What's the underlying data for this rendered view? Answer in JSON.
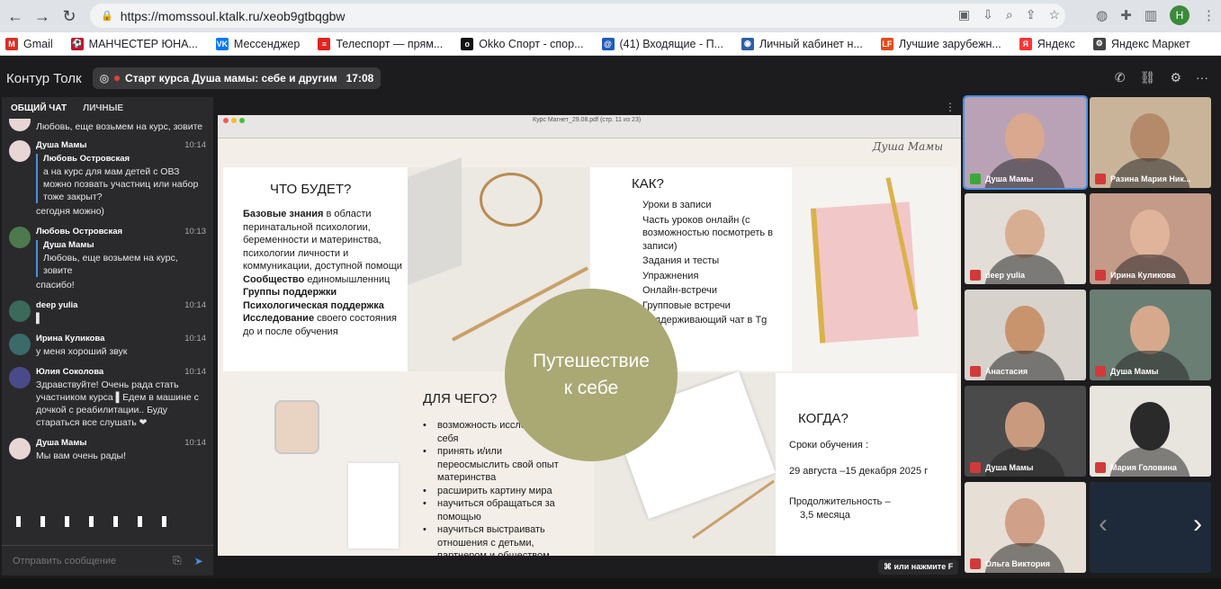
{
  "browser": {
    "url": "https://momssoul.ktalk.ru/xeob9gtbqgbw",
    "profile_initial": "Н",
    "bookmarks": [
      {
        "label": "Gmail",
        "color": "#d93025",
        "glyph": "M"
      },
      {
        "label": "МАНЧЕСТЕР ЮНА...",
        "color": "#c8102e",
        "glyph": "⚽"
      },
      {
        "label": "Мессенджер",
        "color": "#0077ff",
        "glyph": "VK"
      },
      {
        "label": "Телеспорт — прям...",
        "color": "#e0241f",
        "glyph": "≡"
      },
      {
        "label": "Okko Спорт - спор...",
        "color": "#111111",
        "glyph": "o"
      },
      {
        "label": "(41) Входящие - П...",
        "color": "#1e5bbd",
        "glyph": "@"
      },
      {
        "label": "Личный кабинет н...",
        "color": "#2a5fa8",
        "glyph": "◉"
      },
      {
        "label": "Лучшие зарубежн...",
        "color": "#e64a19",
        "glyph": "LF"
      },
      {
        "label": "Яндекс",
        "color": "#ff3333",
        "glyph": "Я"
      },
      {
        "label": "Яндекс Маркет",
        "color": "#444444",
        "glyph": "⚙"
      }
    ]
  },
  "app": {
    "brand": "Контур Толк",
    "meeting_title": "Старт курса Душа мамы: себе и другим",
    "meeting_time": "17:08"
  },
  "chat": {
    "tab_common": "ОБЩИЙ ЧАТ",
    "tab_private": "ЛИЧНЫЕ",
    "top_partial": "Любовь, еще возьмем на курс, зовите",
    "messages": [
      {
        "sender": "Душа Мамы",
        "time": "10:14",
        "avatar": "#e8d6d6",
        "quote_name": "Любовь Островская",
        "quote_text": "а на курс для мам детей с ОВЗ можно позвать участниц или набор тоже закрыт?",
        "text": "сегодня можно)"
      },
      {
        "sender": "Любовь Островская",
        "time": "10:13",
        "avatar": "#4c7a4c",
        "quote_name": "Душа Мамы",
        "quote_text": "Любовь, еще возьмем на курс, зовите",
        "text": "спасибо!"
      },
      {
        "sender": "deep yulia",
        "time": "10:14",
        "avatar": "#3a6a5a",
        "quote_name": "",
        "quote_text": "",
        "text": "▌"
      },
      {
        "sender": "Ирина Куликова",
        "time": "10:14",
        "avatar": "#3a6a6a",
        "quote_name": "",
        "quote_text": "",
        "text": "у меня хороший звук"
      },
      {
        "sender": "Юлия Соколова",
        "time": "10:14",
        "avatar": "#4a4a8a",
        "quote_name": "",
        "quote_text": "",
        "text": "Здравствуйте! Очень рада стать участником курса ▌Едем в машине с дочкой с реабилитации.. Буду стараться все слушать ❤"
      },
      {
        "sender": "Душа Мамы",
        "time": "10:14",
        "avatar": "#e8d6d6",
        "quote_name": "",
        "quote_text": "",
        "text": "Мы вам очень рады!"
      }
    ],
    "composer_placeholder": "Отправить сообщение"
  },
  "pdf": {
    "title": "Курс Магнет_29.08.pdf (стр. 11 из 23)",
    "brand": "Душа Мамы"
  },
  "slide": {
    "what_title": "ЧТО БУДЕТ?",
    "what_items": [
      {
        "bold": "Базовые знания",
        "rest": " в области перинатальной психологии, беременности и материнства, психологии личности и коммуникации, доступной помощи"
      },
      {
        "bold": "Сообщество",
        "rest": " единомышленниц"
      },
      {
        "bold": "Группы поддержки",
        "rest": ""
      },
      {
        "bold": "Психологическая поддержка",
        "rest": ""
      },
      {
        "bold": "Исследование",
        "rest": " своего состояния до и после обучения"
      }
    ],
    "how_title": "КАК?",
    "how_items": [
      "Уроки в записи",
      "Часть уроков онлайн (с возможностью посмотреть в записи)",
      "Задания и тесты",
      "Упражнения",
      "Онлайн-встречи",
      "Групповые встречи",
      "Поддерживающий чат в Tg"
    ],
    "circle_line1": "Путешествие",
    "circle_line2": "к себе",
    "why_title": "ДЛЯ ЧЕГО?",
    "why_items": [
      "возможность исследовать себя",
      "принять и/или переосмыслить свой опыт материнства",
      "расширить картину мира",
      "научиться обращаться за помощью",
      "научиться выстраивать отношения с детьми, партнером и обществом"
    ],
    "when_title": "КОГДА?",
    "when_label": "Сроки обучения :",
    "when_dates": "29  августа –15 декабря 2025 г",
    "duration_label": "Продолжительность –",
    "duration_value": "3,5 месяца"
  },
  "shortcut_hint": "или нажмите F",
  "participants": [
    {
      "name": "Душа Мамы",
      "mic": "on",
      "bg": "#b9a2b5",
      "skin": "#d9a88f"
    },
    {
      "name": "Разина Мария Ник...",
      "mic": "off",
      "bg": "#c9b49a",
      "skin": "#b58a6a"
    },
    {
      "name": "deep yulia",
      "mic": "off",
      "bg": "#e2ddd6",
      "skin": "#d8ae92"
    },
    {
      "name": "Ирина Куликова",
      "mic": "off",
      "bg": "#c49a88",
      "skin": "#e0b49a"
    },
    {
      "name": "Анастасия",
      "mic": "off",
      "bg": "#d8d2cc",
      "skin": "#c8946e"
    },
    {
      "name": "Душа Мамы",
      "mic": "off",
      "bg": "#6b7e74",
      "skin": "#d6a98c"
    },
    {
      "name": "Душа Мамы",
      "mic": "off",
      "bg": "#4a4a4a",
      "skin": "#c99a7e"
    },
    {
      "name": "Мария Головина",
      "mic": "off",
      "bg": "#e8e4de",
      "skin": "#2a2a2a"
    },
    {
      "name": "Ольга Виктория",
      "mic": "off",
      "bg": "#e7ded6",
      "skin": "#d0a088"
    }
  ]
}
